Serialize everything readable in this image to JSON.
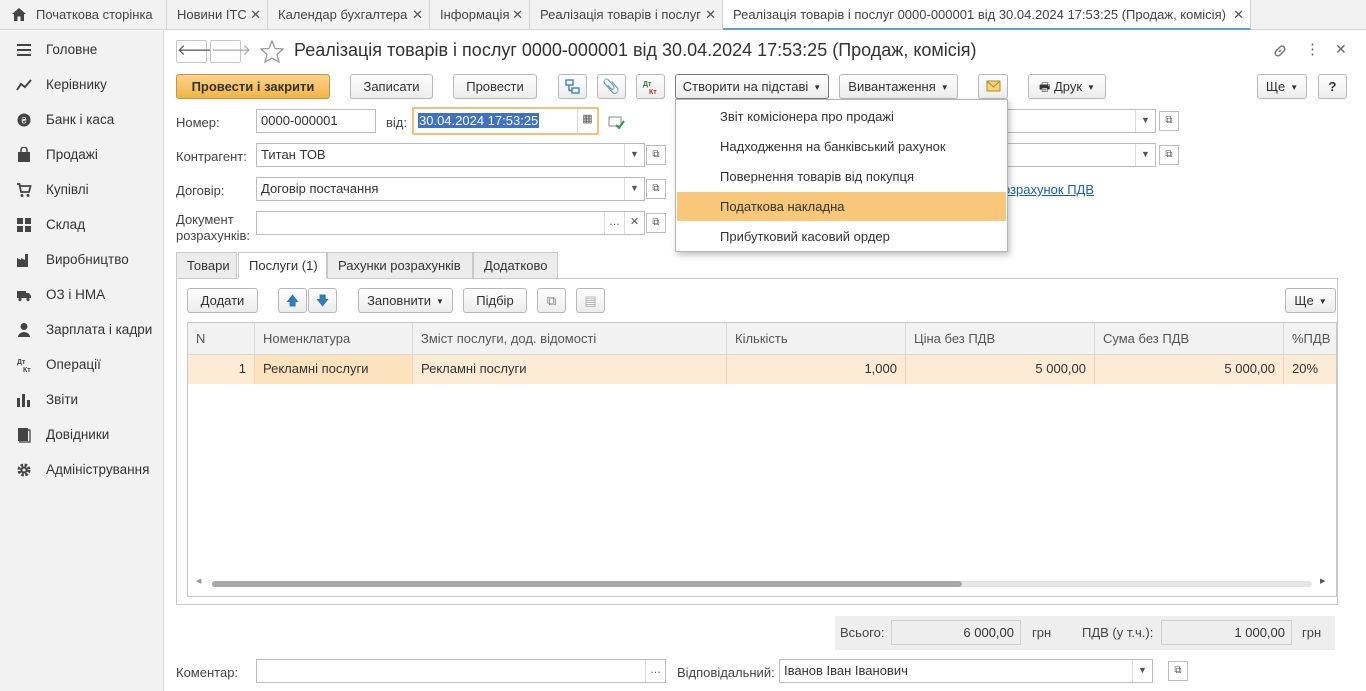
{
  "tabs": {
    "home": "Початкова сторінка",
    "items": [
      "Новини ІТС",
      "Календар бухгалтера",
      "Інформація",
      "Реалізація товарів і послуг",
      "Реалізація товарів і послуг 0000-000001 від 30.04.2024 17:53:25 (Продаж, комісія)"
    ]
  },
  "sidebar": {
    "items": [
      {
        "label": "Головне",
        "icon": "menu-lines-icon"
      },
      {
        "label": "Керівнику",
        "icon": "trend-chart-icon"
      },
      {
        "label": "Банк і каса",
        "icon": "coins-icon"
      },
      {
        "label": "Продажі",
        "icon": "shopping-bag-icon"
      },
      {
        "label": "Купівлі",
        "icon": "cart-icon"
      },
      {
        "label": "Склад",
        "icon": "warehouse-grid-icon"
      },
      {
        "label": "Виробництво",
        "icon": "factory-icon"
      },
      {
        "label": "ОЗ і НМА",
        "icon": "truck-icon"
      },
      {
        "label": "Зарплата і кадри",
        "icon": "person-icon"
      },
      {
        "label": "Операції",
        "icon": "dt-kt-icon"
      },
      {
        "label": "Звіти",
        "icon": "bar-chart-icon"
      },
      {
        "label": "Довідники",
        "icon": "books-icon"
      },
      {
        "label": "Адміністрування",
        "icon": "gear-icon"
      }
    ]
  },
  "doc": {
    "title": "Реалізація товарів і послуг 0000-000001 від 30.04.2024 17:53:25 (Продаж, комісія)"
  },
  "toolbar": {
    "post_close": "Провести і закрити",
    "save": "Записати",
    "post": "Провести",
    "create_based": "Створити на підставі",
    "export": "Вивантаження",
    "print": "Друк",
    "more": "Ще",
    "help": "?"
  },
  "menu": {
    "items": [
      "Звіт комісіонера про продажі",
      "Надходження на банківський рахунок",
      "Повернення товарів від покупця",
      "Податкова накладна",
      "Прибутковий касовий ордер"
    ],
    "highlighted": "Податкова накладна"
  },
  "form": {
    "number_label": "Номер:",
    "number": "0000-000001",
    "date_label": "від:",
    "date": "30.04.2024 17:53:25",
    "counterparty_label": "Контрагент:",
    "counterparty": "Титан ТОВ",
    "contract_label": "Договір:",
    "contract": "Договір постачання",
    "settlement_label_1": "Документ",
    "settlement_label_2": "розрахунків:",
    "settlement": "",
    "vat_link": "озрахунок ПДВ"
  },
  "doc_tabs": [
    "Товари",
    "Послуги (1)",
    "Рахунки розрахунків",
    "Додатково"
  ],
  "table_toolbar": {
    "add": "Додати",
    "fill": "Заповнити",
    "pick": "Підбір",
    "more": "Ще"
  },
  "table": {
    "columns": [
      "N",
      "Номенклатура",
      "Зміст послуги, дод. відомості",
      "Кількість",
      "Ціна без ПДВ",
      "Сума без ПДВ",
      "%ПДВ"
    ],
    "rows": [
      [
        "1",
        "Рекламні послуги",
        "Рекламні послуги",
        "1,000",
        "5 000,00",
        "5 000,00",
        "20%"
      ]
    ]
  },
  "totals": {
    "total_label": "Всього:",
    "total": "6 000,00",
    "currency": "грн",
    "vat_label": "ПДВ (у т.ч.):",
    "vat": "1 000,00",
    "vat_currency": "грн"
  },
  "footer": {
    "comment_label": "Коментар:",
    "comment": "",
    "responsible_label": "Відповідальний:",
    "responsible": "Іванов Іван Іванович"
  },
  "colors": {
    "primary_button": "#f2b545",
    "selected_row": "#fcecd6",
    "menu_highlight": "#f9c77a",
    "active_tab_line": "#5fa0c9"
  }
}
